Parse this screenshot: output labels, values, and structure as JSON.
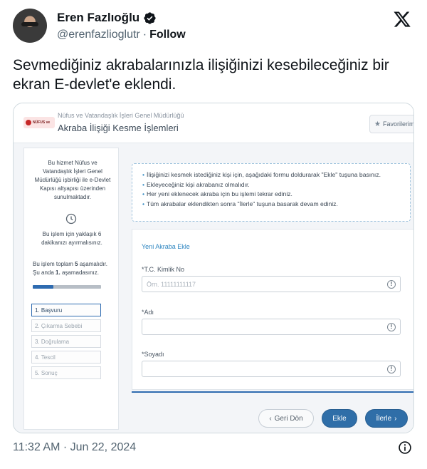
{
  "tweet": {
    "author_name": "Eren Fazlıoğlu",
    "handle": "@erenfazlioglutr",
    "separator": "·",
    "follow_label": "Follow",
    "text": "Sevmediğiniz akrabalarınızla ilişiğinizi kesebileceğiniz bir ekran E-devlet'e eklendi.",
    "timestamp": "11:32 AM · Jun 22, 2024"
  },
  "screenshot": {
    "logo_text": "NÜFUS ve",
    "org_name": "Nüfus ve Vatandaşlık İşleri Genel Müdürlüğü",
    "page_title": "Akraba İlişiği Kesme İşlemleri",
    "favorites_label": "Favorilerime",
    "sidebar": {
      "info": "Bu hizmet Nüfus ve Vatandaşlık İşleri Genel Müdürlüğü işbirliği ile e-Devlet Kapısı altyapısı üzerinden sunulmaktadır.",
      "time_note": "Bu işlem için yaklaşık 6 dakikanızı ayırmalısınız.",
      "stage_prefix": "Bu işlem toplam",
      "stage_total": "5",
      "stage_middle": "aşamalıdır. Şu anda",
      "stage_current": "1.",
      "stage_suffix": "aşamadasınız.",
      "progress_fraction": 0.3,
      "steps": [
        "1. Başvuru",
        "2. Çıkarma Sebebi",
        "3. Doğrulama",
        "4. Tescil",
        "5. Sonuç"
      ]
    },
    "info_lines": [
      "İlişiğinizi kesmek istediğiniz kişi için, aşağıdaki formu doldurarak \"Ekle\" tuşuna basınız.",
      "Ekleyeceğiniz kişi akrabanız olmalıdır.",
      "Her yeni eklenecek akraba için bu işlemi tekrar ediniz.",
      "Tüm akrabalar eklendikten sonra \"İlerle\" tuşuna basarak devam ediniz."
    ],
    "form": {
      "heading": "Yeni Akraba Ekle",
      "tc_label": "*T.C. Kimlik No",
      "tc_placeholder": "Örn. 11111111117",
      "name_label": "*Adı",
      "surname_label": "*Soyadı",
      "info_glyph": "!"
    },
    "buttons": {
      "back": "Geri Dön",
      "add": "Ekle",
      "next": "İlerle"
    }
  },
  "colors": {
    "accent_blue": "#2f6ea8",
    "link_blue": "#2e86c1",
    "verified_blue": "#1d9bf0"
  }
}
